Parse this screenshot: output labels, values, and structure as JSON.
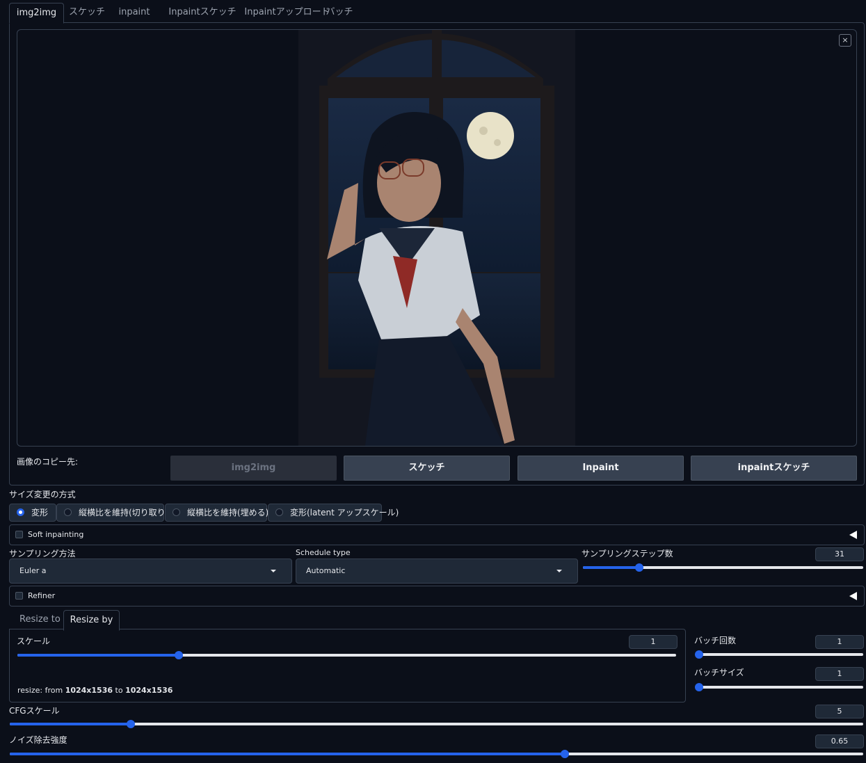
{
  "tabs": [
    "img2img",
    "スケッチ",
    "inpaint",
    "Inpaintスケッチ",
    "Inpaintアップロード",
    "バッチ"
  ],
  "image": {
    "close_label": "×"
  },
  "copy_to": {
    "label": "画像のコピー先:",
    "buttons": [
      "img2img",
      "スケッチ",
      "Inpaint",
      "inpaintスケッチ"
    ]
  },
  "resize_mode": {
    "label": "サイズ変更の方式",
    "options": [
      "変形",
      "縦横比を維持(切り取り)",
      "縦横比を維持(埋める)",
      "変形(latent アップスケール)"
    ],
    "selected": "変形"
  },
  "soft_inpainting": {
    "label": "Soft inpainting",
    "checked": false
  },
  "sampling": {
    "method_label": "サンプリング方法",
    "method_value": "Euler a",
    "schedule_label": "Schedule type",
    "schedule_value": "Automatic",
    "steps_label": "サンプリングステップ数",
    "steps_value": "31",
    "steps_fraction": 0.2
  },
  "refiner": {
    "label": "Refiner",
    "checked": false
  },
  "resize_tabs": [
    "Resize to",
    "Resize by"
  ],
  "scale": {
    "label": "スケール",
    "value": "1",
    "fraction": 0.245
  },
  "resize_info": {
    "prefix": "resize: from ",
    "from": "1024x1536",
    "mid": " to ",
    "to": "1024x1536"
  },
  "batch_count": {
    "label": "バッチ回数",
    "value": "1",
    "fraction": 0.0
  },
  "batch_size": {
    "label": "バッチサイズ",
    "value": "1",
    "fraction": 0.0
  },
  "cfg": {
    "label": "CFGスケール",
    "value": "5",
    "fraction": 0.142
  },
  "denoise": {
    "label": "ノイズ除去強度",
    "value": "0.65",
    "fraction": 0.65
  },
  "colors": {
    "accent": "#2563eb",
    "background": "#0b0f19",
    "border": "#374151"
  }
}
